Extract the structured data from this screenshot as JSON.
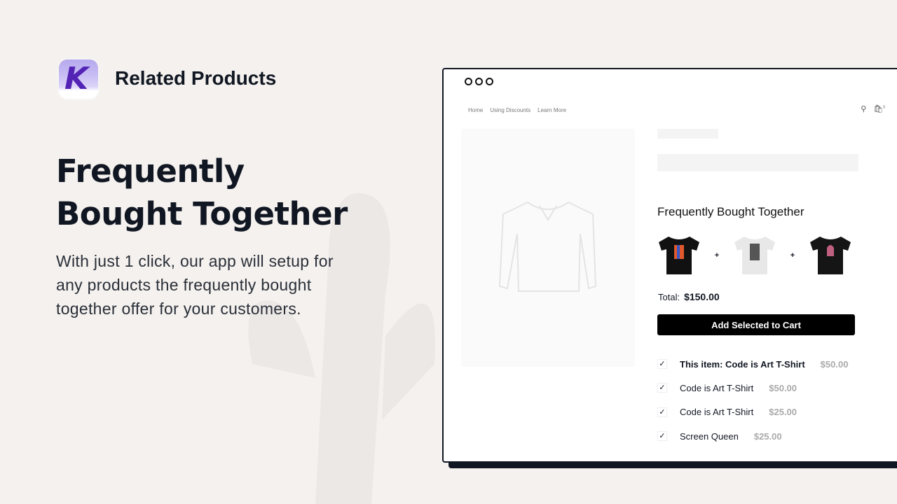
{
  "brand": {
    "logo_letter": "K",
    "name": "Related Products"
  },
  "hero": {
    "title": "Frequently Bought Together",
    "description": "With just 1 click, our app will setup for any products the frequently bought together offer for your customers."
  },
  "store": {
    "nav": [
      "Home",
      "Using Discounts",
      "Learn More"
    ],
    "cart_count": "0",
    "section_title": "Frequently Bought Together",
    "plus": "+",
    "total_label": "Total:",
    "total_value": "$150.00",
    "add_button": "Add Selected to Cart",
    "items": [
      {
        "name": "This item: Code is Art T-Shirt",
        "price": "$50.00",
        "checked": true
      },
      {
        "name": "Code is Art T-Shirt",
        "price": "$50.00",
        "checked": true
      },
      {
        "name": "Code is Art T-Shirt",
        "price": "$25.00",
        "checked": true
      },
      {
        "name": "Screen Queen",
        "price": "$25.00",
        "checked": true
      }
    ],
    "check": "✓"
  },
  "colors": {
    "background": "#f4f1ee",
    "accent": "#5223b5",
    "button": "#000000"
  }
}
